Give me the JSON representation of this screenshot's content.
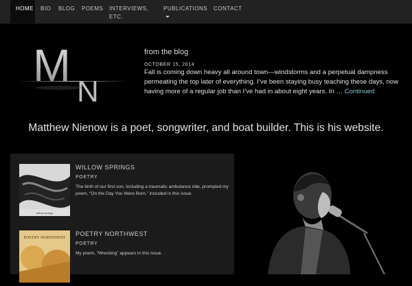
{
  "nav": {
    "items": [
      {
        "label": "Home",
        "active": true
      },
      {
        "label": "Bio"
      },
      {
        "label": "Blog"
      },
      {
        "label": "Poems"
      },
      {
        "label": "Interviews, etc."
      },
      {
        "label": "Publications"
      },
      {
        "label": "Contact"
      }
    ]
  },
  "logo": {
    "letters": "MN"
  },
  "blog": {
    "heading": "from the blog",
    "date": "OCTOBER 15, 2014",
    "excerpt": "Fall is coming down heavy all around town—windstorms and a perpetual dampness permeating the top later of everything.  I’ve been staying busy teaching these days, now having more of a regular job than I’ve had in about eight years.  In … ",
    "continue_label": "Continued"
  },
  "tagline": "Matthew Nienow is a poet, songwriter, and boat builder. This is his website.",
  "publications": [
    {
      "title": "WILLOW SPRINGS",
      "category": "POETRY",
      "description": "The birth of our first son, including a traumatic ambulance ride, prompted my poem, “On the Day You Were Born,” included in this issue.",
      "cover_text": "willow springs"
    },
    {
      "title": "POETRY NORTHWEST",
      "category": "POETRY",
      "description": "My poem, “Wrecking” appears in this issue.",
      "cover_text": "POETRY NORTHWEST"
    }
  ],
  "colors": {
    "nav_bg": "#222222",
    "panel_bg": "#1b1b1b",
    "link": "#8fc3ce"
  }
}
